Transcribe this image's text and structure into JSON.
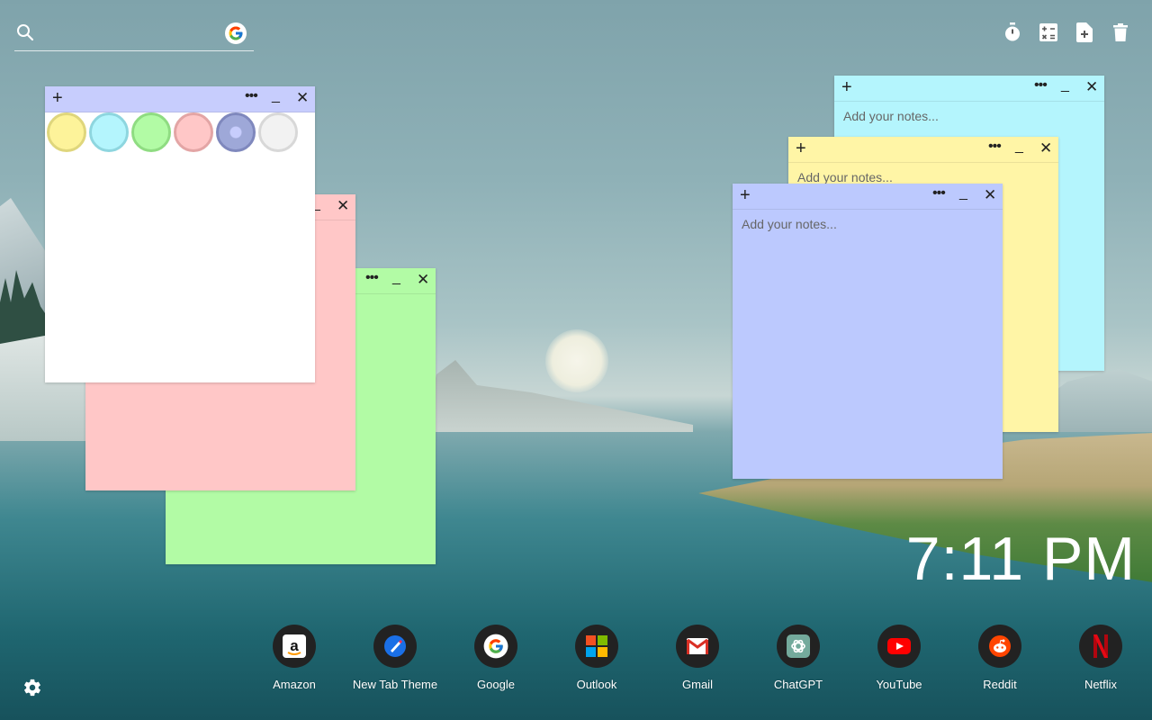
{
  "search": {
    "placeholder": "",
    "value": ""
  },
  "top_actions": [
    {
      "icon": "timer-icon"
    },
    {
      "icon": "calculator-icon"
    },
    {
      "icon": "add-note-icon"
    },
    {
      "icon": "trash-icon"
    }
  ],
  "notes": {
    "glyphs": {
      "add": "+",
      "menu": "•••",
      "minimize": "_",
      "close": "✕"
    },
    "placeholder": "Add your notes...",
    "colors": {
      "green": "#b2fba5",
      "pink": "#ffc7c7",
      "white": "#ffffff",
      "cyan": "#b4f5fd",
      "yellow": "#fff5a6",
      "blue": "#bcc9fe"
    }
  },
  "color_swatches": [
    {
      "name": "yellow",
      "fill": "#fdf39a",
      "ring": "#dfd67c"
    },
    {
      "name": "cyan",
      "fill": "#b4f5fd",
      "ring": "#8ed6df"
    },
    {
      "name": "green",
      "fill": "#b2fba5",
      "ring": "#8fdc82"
    },
    {
      "name": "pink",
      "fill": "#ffc7c7",
      "ring": "#e3a5a5"
    },
    {
      "name": "blue",
      "fill": "#9ea8d8",
      "ring": "#7f88bd"
    },
    {
      "name": "white",
      "fill": "#f2f2f2",
      "ring": "#d8d8d8"
    }
  ],
  "clock": {
    "time": "7:11 PM"
  },
  "dock": [
    {
      "label": "Amazon",
      "icon": "amazon-icon"
    },
    {
      "label": "New Tab Theme",
      "icon": "new-tab-theme-icon"
    },
    {
      "label": "Google",
      "icon": "google-icon"
    },
    {
      "label": "Outlook",
      "icon": "outlook-icon"
    },
    {
      "label": "Gmail",
      "icon": "gmail-icon"
    },
    {
      "label": "ChatGPT",
      "icon": "chatgpt-icon"
    },
    {
      "label": "YouTube",
      "icon": "youtube-icon"
    },
    {
      "label": "Reddit",
      "icon": "reddit-icon"
    },
    {
      "label": "Netflix",
      "icon": "netflix-icon"
    }
  ]
}
